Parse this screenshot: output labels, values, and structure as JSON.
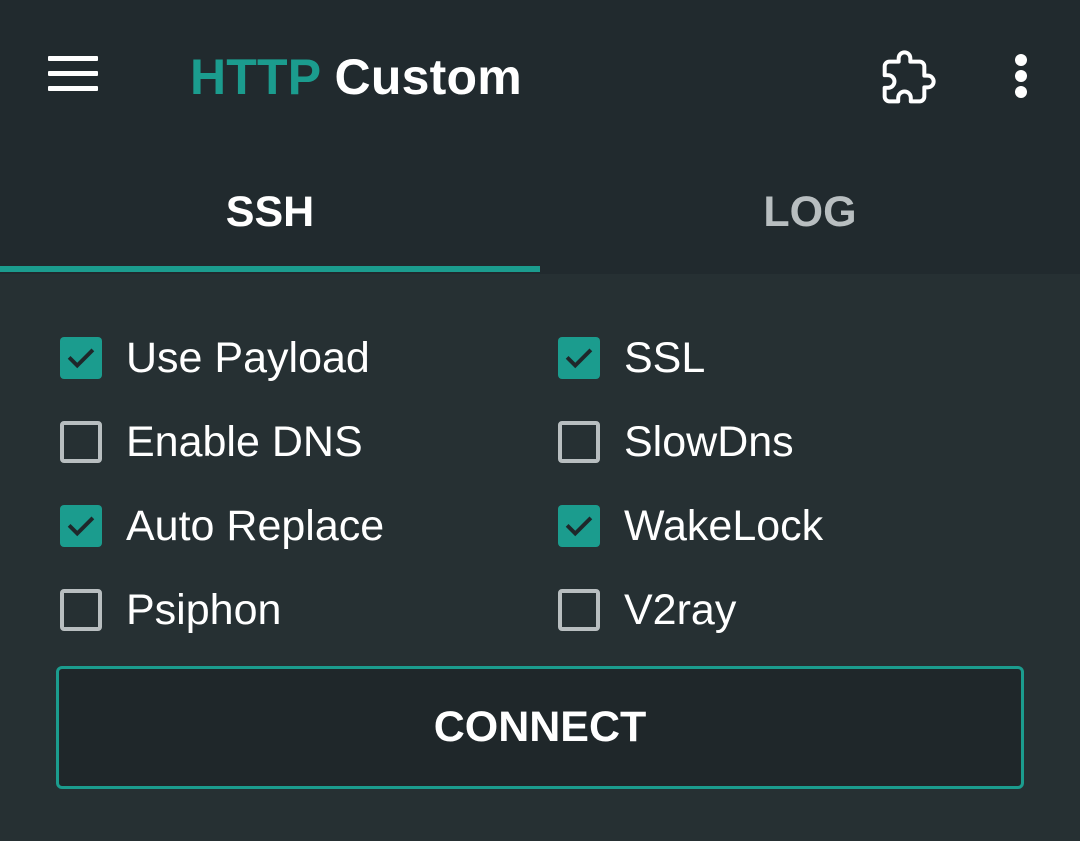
{
  "app": {
    "title_accent": "HTTP",
    "title_rest": "Custom"
  },
  "toolbar": {
    "menu_icon": "hamburger-menu-icon",
    "extension_icon": "puzzle-piece-icon",
    "overflow_icon": "more-vert-icon"
  },
  "tabs": [
    {
      "label": "SSH",
      "active": true
    },
    {
      "label": "LOG",
      "active": false
    }
  ],
  "options": [
    {
      "label": "Use Payload",
      "checked": true
    },
    {
      "label": "SSL",
      "checked": true
    },
    {
      "label": "Enable DNS",
      "checked": false
    },
    {
      "label": "SlowDns",
      "checked": false
    },
    {
      "label": "Auto Replace",
      "checked": true
    },
    {
      "label": "WakeLock",
      "checked": true
    },
    {
      "label": "Psiphon",
      "checked": false
    },
    {
      "label": "V2ray",
      "checked": false
    }
  ],
  "connect": {
    "label": "CONNECT"
  },
  "colors": {
    "accent": "#1b9c8e",
    "toolbar_bg": "#212a2e",
    "content_bg": "#263033",
    "text": "#ffffff",
    "muted": "#b8bec0"
  }
}
